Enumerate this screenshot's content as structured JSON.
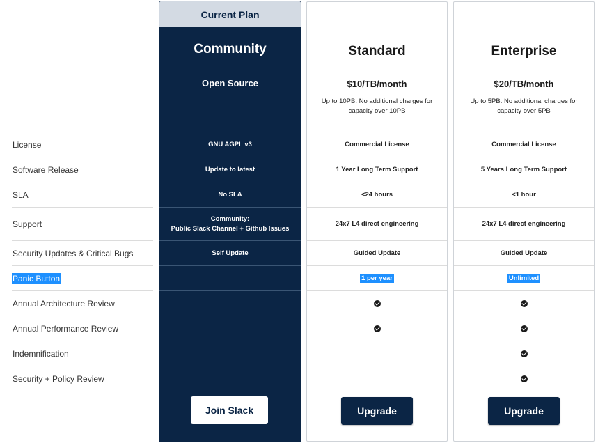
{
  "features": [
    "License",
    "Software Release",
    "SLA",
    "Support",
    "Security Updates & Critical Bugs",
    "Panic Button",
    "Annual Architecture Review",
    "Annual Performance Review",
    "Indemnification",
    "Security + Policy Review"
  ],
  "community": {
    "tag": "Current Plan",
    "name": "Community",
    "sub": "Open Source",
    "license": "GNU AGPL v3",
    "release": "Update to latest",
    "sla": "No SLA",
    "support_line1": "Community:",
    "support_line2": "Public Slack Channel + Github Issues",
    "security": "Self Update",
    "button": "Join Slack"
  },
  "standard": {
    "name": "Standard",
    "price": "$10/TB/month",
    "desc": "Up to 10PB. No additional charges for capacity over 10PB",
    "license": "Commercial License",
    "release": "1 Year Long Term Support",
    "sla": "<24 hours",
    "support": "24x7 L4 direct engineering",
    "security": "Guided Update",
    "panic": "1 per year",
    "button": "Upgrade"
  },
  "enterprise": {
    "name": "Enterprise",
    "price": "$20/TB/month",
    "desc": "Up to 5PB. No additional charges for capacity over 5PB",
    "license": "Commercial License",
    "release": "5 Years Long Term Support",
    "sla": "<1 hour",
    "support": "24x7 L4 direct engineering",
    "security": "Guided Update",
    "panic": "Unlimited",
    "button": "Upgrade"
  },
  "icons": {
    "included": "check-circle-icon"
  },
  "colors": {
    "navy": "#0b2545",
    "tag_bg": "#d3dae3",
    "highlight": "#1e90ff"
  }
}
